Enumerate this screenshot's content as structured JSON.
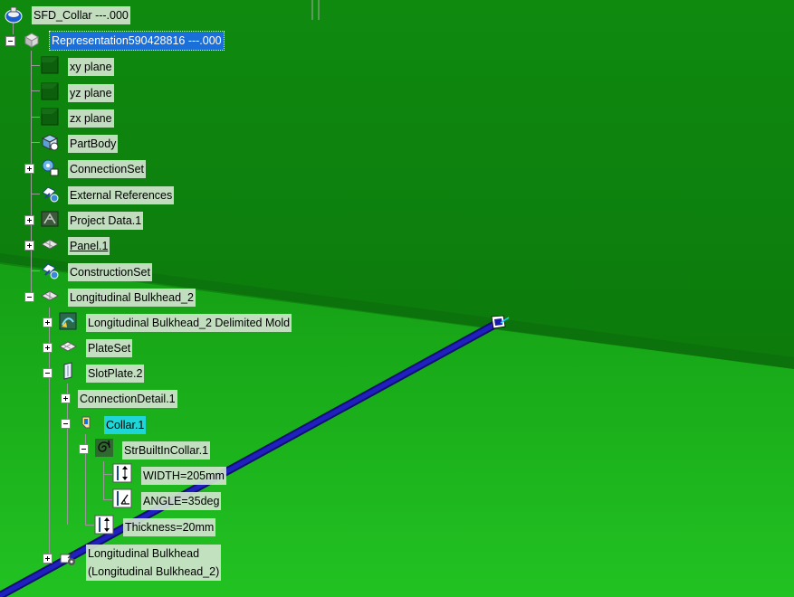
{
  "tree": {
    "root": {
      "label": "SFD_Collar ---.000",
      "icon": "product-root-icon"
    },
    "nodes": [
      {
        "key": "representation",
        "label": "Representation590428816 ---.000",
        "icon": "part-representation-icon"
      },
      {
        "key": "xy_plane",
        "label": "xy plane",
        "icon": "plane-icon"
      },
      {
        "key": "yz_plane",
        "label": "yz plane",
        "icon": "plane-icon"
      },
      {
        "key": "zx_plane",
        "label": "zx plane",
        "icon": "plane-icon"
      },
      {
        "key": "partbody",
        "label": "PartBody",
        "icon": "part-body-icon"
      },
      {
        "key": "connectionset",
        "label": "ConnectionSet",
        "icon": "connection-set-icon"
      },
      {
        "key": "external_refs",
        "label": "External References",
        "icon": "external-references-icon"
      },
      {
        "key": "project_data",
        "label": "Project Data.1",
        "icon": "project-data-icon"
      },
      {
        "key": "panel",
        "label": "Panel.1",
        "icon": "panel-icon"
      },
      {
        "key": "constructionset",
        "label": "ConstructionSet",
        "icon": "construction-set-icon"
      },
      {
        "key": "long_bulkhead_2",
        "label": "Longitudinal Bulkhead_2",
        "icon": "panel-icon"
      },
      {
        "key": "delimited_mold",
        "label": "Longitudinal Bulkhead_2 Delimited Mold",
        "icon": "mold-icon"
      },
      {
        "key": "plateset",
        "label": "PlateSet",
        "icon": "plate-set-icon"
      },
      {
        "key": "slotplate",
        "label": "SlotPlate.2",
        "icon": "plate-icon"
      },
      {
        "key": "connectiondetail",
        "label": "ConnectionDetail.1",
        "icon": ""
      },
      {
        "key": "collar",
        "label": "Collar.1",
        "icon": "collar-icon"
      },
      {
        "key": "strbuilt",
        "label": "StrBuiltInCollar.1",
        "icon": "spiral-icon"
      },
      {
        "key": "width",
        "label": "WIDTH=205mm",
        "icon": "parameter-icon"
      },
      {
        "key": "angle",
        "label": "ANGLE=35deg",
        "icon": "angle-parameter-icon"
      },
      {
        "key": "thickness",
        "label": "Thickness=20mm",
        "icon": "parameter-icon"
      },
      {
        "key": "long_bulkhead",
        "label_line1": "Longitudinal Bulkhead",
        "label_line2": "(Longitudinal Bulkhead_2)",
        "icon": "bulkhead-link-icon"
      }
    ]
  },
  "viewport": {
    "background_top": "#0a7a0a",
    "background_bottom": "#1fb81f",
    "stiffener_color": "#1a1aa8",
    "handle_icon": "compass-handle-icon"
  }
}
